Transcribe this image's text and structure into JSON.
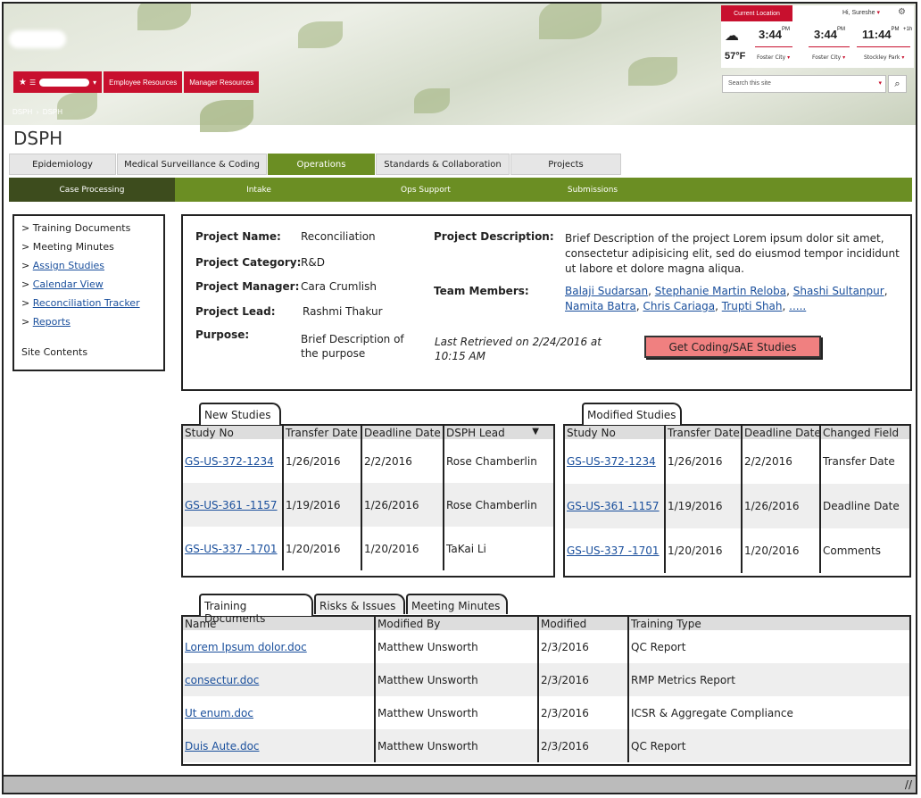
{
  "header": {
    "current_location": "Current Location",
    "greeting": "Hi, Sureshe",
    "clocks": [
      {
        "time": "3:44",
        "ampm": "PM",
        "location": "Foster City"
      },
      {
        "time": "3:44",
        "ampm": "PM",
        "location": "Foster City"
      },
      {
        "time": "11:44",
        "ampm": "PM",
        "offset": "+1h",
        "location": "Stockley Park"
      }
    ],
    "temperature": "57°F",
    "search_placeholder": "Search this site",
    "nav": [
      "Employee Resources",
      "Manager Resources"
    ],
    "breadcrumb": [
      "DSPH",
      "DSPH"
    ]
  },
  "page_title": "DSPH",
  "tabs": [
    "Epidemiology",
    "Medical Surveillance & Coding",
    "Operations",
    "Standards & Collaboration",
    "Projects"
  ],
  "subnav": [
    "Case Processing",
    "Intake",
    "Ops Support",
    "Submissions"
  ],
  "sidebar": {
    "items": [
      {
        "label": "Training Documents",
        "link": false
      },
      {
        "label": "Meeting Minutes",
        "link": false
      },
      {
        "label": "Assign Studies",
        "link": true
      },
      {
        "label": "Calendar View",
        "link": true
      },
      {
        "label": "Reconciliation Tracker",
        "link": true
      },
      {
        "label": "Reports",
        "link": true
      }
    ],
    "site_contents": "Site Contents"
  },
  "project": {
    "name_label": "Project Name:",
    "name": "Reconciliation",
    "category_label": "Project Category:",
    "category": "R&D",
    "manager_label": "Project Manager:",
    "manager": "Cara Crumlish",
    "lead_label": "Project Lead:",
    "lead": "Rashmi Thakur",
    "purpose_label": "Purpose:",
    "purpose": "Brief Description of the purpose",
    "description_label": "Project Description:",
    "description": "Brief Description of the project Lorem ipsum dolor sit amet, consectetur adipisicing elit, sed do eiusmod tempor incididunt ut labore et dolore magna aliqua.",
    "team_label": "Team Members:",
    "team": [
      "Balaji Sudarsan",
      "Stephanie Martin Reloba",
      "Shashi Sultanpur",
      "Namita Batra",
      "Chris Cariaga",
      "Trupti Shah",
      "....."
    ],
    "retrieved": "Last Retrieved on 2/24/2016 at 10:15 AM",
    "button": "Get Coding/SAE Studies"
  },
  "new_studies": {
    "tab": "New Studies",
    "columns": [
      "Study No",
      "Transfer Date",
      "Deadline Date",
      "DSPH Lead"
    ],
    "rows": [
      [
        "GS-US-372-1234",
        "1/26/2016",
        "2/2/2016",
        "Rose Chamberlin"
      ],
      [
        "GS-US-361 -1157",
        "1/19/2016",
        "1/26/2016",
        "Rose Chamberlin"
      ],
      [
        "GS-US-337 -1701",
        "1/20/2016",
        "1/20/2016",
        "TaKai Li"
      ]
    ]
  },
  "modified_studies": {
    "tab": "Modified Studies",
    "columns": [
      "Study No",
      "Transfer Date",
      "Deadline Date",
      "Changed Field"
    ],
    "rows": [
      [
        "GS-US-372-1234",
        "1/26/2016",
        "2/2/2016",
        "Transfer Date"
      ],
      [
        "GS-US-361 -1157",
        "1/19/2016",
        "1/26/2016",
        "Deadline Date"
      ],
      [
        "GS-US-337 -1701",
        "1/20/2016",
        "1/20/2016",
        "Comments"
      ]
    ]
  },
  "docs": {
    "tabs": [
      "Training Documents",
      "Risks & Issues",
      "Meeting Minutes"
    ],
    "columns": [
      "Name",
      "Modified By",
      "Modified",
      "Training Type"
    ],
    "rows": [
      [
        "Lorem Ipsum dolor.doc",
        "Matthew Unsworth",
        "2/3/2016",
        "QC Report"
      ],
      [
        "consectur.doc",
        "Matthew Unsworth",
        "2/3/2016",
        "RMP Metrics Report"
      ],
      [
        "Ut enum.doc",
        "Matthew Unsworth",
        "2/3/2016",
        "ICSR & Aggregate Compliance"
      ],
      [
        "Duis Aute.doc",
        "Matthew Unsworth",
        "2/3/2016",
        "QC Report"
      ]
    ]
  },
  "colors": {
    "brand_red": "#c8102e",
    "olive": "#6b8e23",
    "dark_olive": "#3d4c1d",
    "link": "#1a4f9c",
    "button": "#f08080"
  }
}
